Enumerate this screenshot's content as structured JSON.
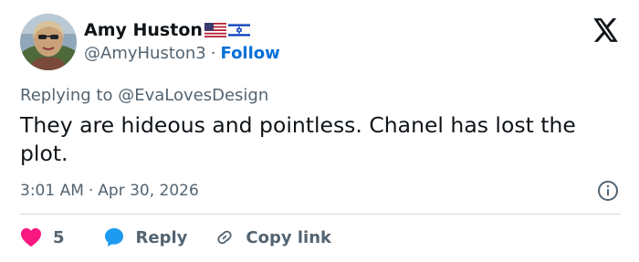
{
  "author": {
    "name": "Amy Huston",
    "handle": "@AmyHuston3",
    "separator": "·",
    "follow_label": "Follow",
    "flags": [
      "us-flag-icon",
      "israel-flag-icon"
    ]
  },
  "reply_context": {
    "prefix": "Replying to ",
    "mention": "@EvaLovesDesign"
  },
  "tweet": {
    "text": "They are hideous and pointless. Chanel has lost the plot."
  },
  "meta": {
    "time": "3:01 AM",
    "separator": "·",
    "date": "Apr 30, 2026"
  },
  "actions": {
    "like_count": "5",
    "reply_label": "Reply",
    "copy_label": "Copy link"
  },
  "colors": {
    "text": "#0f1419",
    "secondary": "#536471",
    "link": "#006fd6",
    "heart": "#f91880",
    "reply_bubble": "#1d9bf0",
    "divider": "#cfd9de"
  }
}
